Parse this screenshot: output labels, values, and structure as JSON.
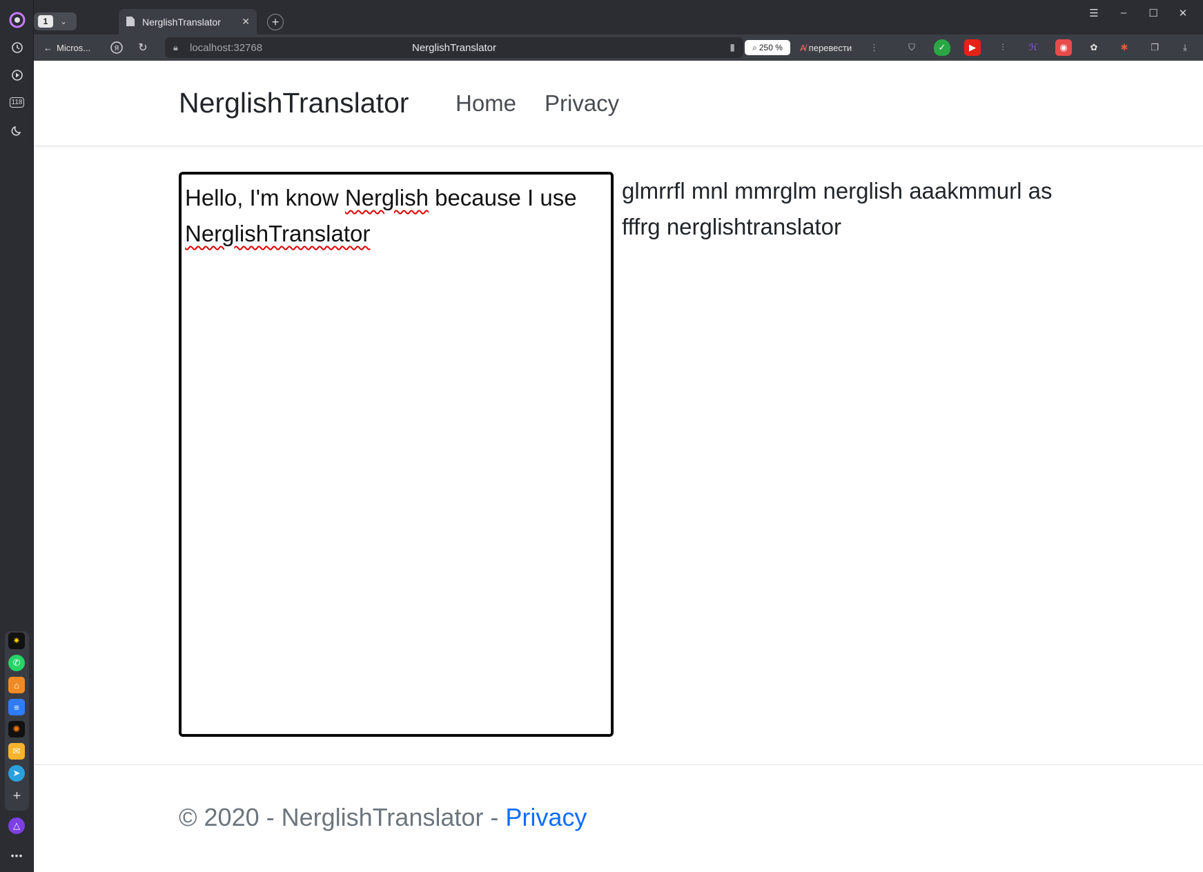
{
  "browser": {
    "tab_count": "1",
    "tab_title": "NerglishTranslator",
    "back_label": "Micros...",
    "url_host": "localhost:32768",
    "page_title": "NerglishTranslator",
    "zoom": "250 %",
    "translate_label": "перевести",
    "sidebar_badge": "118"
  },
  "navbar": {
    "brand": "NerglishTranslator",
    "links": [
      "Home",
      "Privacy"
    ]
  },
  "translator": {
    "input_text_word1": "Hello, I'm know ",
    "input_text_word2": "Nerglish",
    "input_text_word3": " because I use ",
    "input_text_word4": "NerglishTranslator",
    "output_text": "glmrrfl mnl mmrglm nerglish aaakmmurl as fffrg nerglishtranslator"
  },
  "footer": {
    "copyright": "© 2020 - NerglishTranslator - ",
    "privacy_link": "Privacy"
  },
  "colors": {
    "link": "#0d6efd",
    "browser_dark": "#2b2d33"
  }
}
